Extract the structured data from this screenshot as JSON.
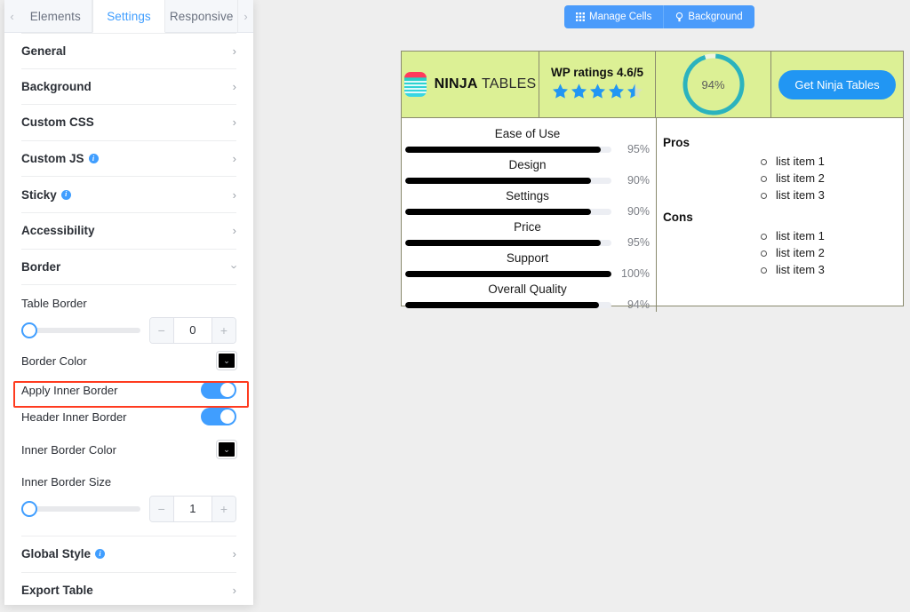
{
  "sidebar": {
    "tabs": [
      {
        "label": "Elements",
        "active": false
      },
      {
        "label": "Settings",
        "active": true
      },
      {
        "label": "Responsive",
        "active": false
      }
    ],
    "prev_arrow": "‹",
    "next_arrow": "›",
    "accordions": [
      {
        "label": "General",
        "state": "collapsed",
        "info": false
      },
      {
        "label": "Background",
        "state": "collapsed",
        "info": false
      },
      {
        "label": "Custom CSS",
        "state": "collapsed",
        "info": false
      },
      {
        "label": "Custom JS",
        "state": "collapsed",
        "info": true
      },
      {
        "label": "Sticky",
        "state": "collapsed",
        "info": true
      },
      {
        "label": "Accessibility",
        "state": "collapsed",
        "info": false
      },
      {
        "label": "Border",
        "state": "expanded",
        "info": false
      }
    ],
    "border_section": {
      "table_border_label": "Table Border",
      "table_border_value": "0",
      "border_color_label": "Border Color",
      "border_color_value": "#000000",
      "apply_inner_border_label": "Apply Inner Border",
      "apply_inner_border_on": true,
      "header_inner_border_label": "Header Inner Border",
      "header_inner_border_on": true,
      "inner_border_color_label": "Inner Border Color",
      "inner_border_color_value": "#000000",
      "inner_border_size_label": "Inner Border Size",
      "inner_border_size_value": "1",
      "minus_label": "−",
      "plus_label": "+"
    },
    "footer_accordions": [
      {
        "label": "Global Style",
        "state": "collapsed",
        "info": true
      },
      {
        "label": "Export Table",
        "state": "collapsed",
        "info": false
      }
    ],
    "highlight_color": "#ff3b1f",
    "highlighted_row": "Apply Inner Border"
  },
  "toolbar": {
    "buttons": [
      {
        "label": "Manage Cells",
        "icon": "grid-icon"
      },
      {
        "label": "Background",
        "icon": "bulb-icon"
      }
    ],
    "color": "#4a9bfb"
  },
  "table": {
    "header_bg": "#dcf095",
    "border_color": "#8a8a6e",
    "logo": {
      "bold": "NINJA",
      "light": " TABLES"
    },
    "rating": {
      "title": "WP ratings 4.6/5",
      "value": 4.6,
      "max": 5,
      "full_stars": 4,
      "half_stars": 1,
      "star_color": "#2196f3"
    },
    "score": {
      "percent": 94,
      "label": "94%",
      "ring_color": "#2bb3bd",
      "track_color": "#f0f5e0"
    },
    "cta": {
      "label": "Get Ninja Tables",
      "color": "#2196f3"
    },
    "bars": [
      {
        "label": "Ease of Use",
        "value": 95,
        "display": "95%"
      },
      {
        "label": "Design",
        "value": 90,
        "display": "90%"
      },
      {
        "label": "Settings",
        "value": 90,
        "display": "90%"
      },
      {
        "label": "Price",
        "value": 95,
        "display": "95%"
      },
      {
        "label": "Support",
        "value": 100,
        "display": "100%"
      },
      {
        "label": "Overall Quality",
        "value": 94,
        "display": "94%"
      }
    ],
    "pros": {
      "heading": "Pros",
      "items": [
        "list item 1",
        "list item 2",
        "list item 3"
      ]
    },
    "cons": {
      "heading": "Cons",
      "items": [
        "list item 1",
        "list item 2",
        "list item 3"
      ]
    }
  }
}
